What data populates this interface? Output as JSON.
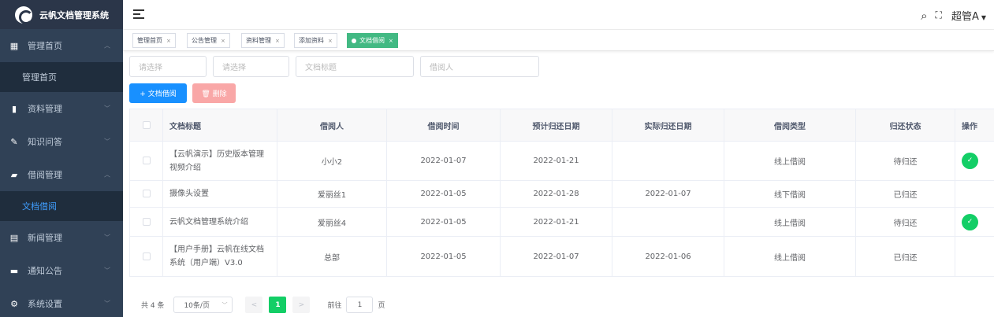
{
  "app": {
    "title": "云帆文档管理系统"
  },
  "sidebar": {
    "items": [
      {
        "label": "管理首页",
        "icon": "dashboard-icon",
        "glyph": "▦",
        "arrow": "︿"
      },
      {
        "label": "管理首页",
        "sub": true
      },
      {
        "label": "资料管理",
        "icon": "books-icon",
        "glyph": "▮",
        "arrow": "﹀"
      },
      {
        "label": "知识问答",
        "icon": "edit-icon",
        "glyph": "✎",
        "arrow": "﹀"
      },
      {
        "label": "借阅管理",
        "icon": "box-icon",
        "glyph": "▰",
        "arrow": "︿"
      },
      {
        "label": "文档借阅",
        "sub": true,
        "active": true
      },
      {
        "label": "新闻管理",
        "icon": "news-icon",
        "glyph": "▤",
        "arrow": "﹀"
      },
      {
        "label": "通知公告",
        "icon": "message-icon",
        "glyph": "▬",
        "arrow": "﹀"
      },
      {
        "label": "系统设置",
        "icon": "gear-icon",
        "glyph": "⚙",
        "arrow": "﹀"
      }
    ]
  },
  "header": {
    "user": "超管A"
  },
  "tags": [
    {
      "label": "管理首页",
      "close": "×"
    },
    {
      "label": "公告管理",
      "close": "×"
    },
    {
      "label": "资料管理",
      "close": "×"
    },
    {
      "label": "添加资料",
      "close": "×"
    },
    {
      "label": "文档借阅",
      "close": "×",
      "active": true
    }
  ],
  "filters": {
    "select1": "请选择",
    "select2": "请选择",
    "title": "文档标题",
    "borrower": "借阅人"
  },
  "buttons": {
    "add": "+ 文档借阅",
    "delete": "🗑 删除"
  },
  "table": {
    "headers": [
      "",
      "文档标题",
      "借阅人",
      "借阅时间",
      "预计归还日期",
      "实际归还日期",
      "借阅类型",
      "归还状态",
      "操作"
    ],
    "rows": [
      {
        "title": "【云帆演示】历史版本管理视频介绍",
        "borrower": "小小2",
        "borrow_time": "2022-01-07",
        "expected": "2022-01-21",
        "actual": "",
        "type": "线上借阅",
        "status": "待归还",
        "action": true
      },
      {
        "title": "摄像头设置",
        "borrower": "爱丽丝1",
        "borrow_time": "2022-01-05",
        "expected": "2022-01-28",
        "actual": "2022-01-07",
        "type": "线下借阅",
        "status": "已归还",
        "action": false
      },
      {
        "title": "云帆文档管理系统介绍",
        "borrower": "爱丽丝4",
        "borrow_time": "2022-01-05",
        "expected": "2022-01-21",
        "actual": "",
        "type": "线上借阅",
        "status": "待归还",
        "action": true
      },
      {
        "title": "【用户手册】云帆在线文档系统（用户端）V3.0",
        "borrower": "总部",
        "borrow_time": "2022-01-05",
        "expected": "2022-01-07",
        "actual": "2022-01-06",
        "type": "线上借阅",
        "status": "已归还",
        "action": false
      }
    ]
  },
  "pagination": {
    "total": "共 4 条",
    "page_size": "10条/页",
    "prev": "<",
    "current": "1",
    "next": ">",
    "goto_label": "前往",
    "goto_value": "1",
    "goto_suffix": "页"
  }
}
